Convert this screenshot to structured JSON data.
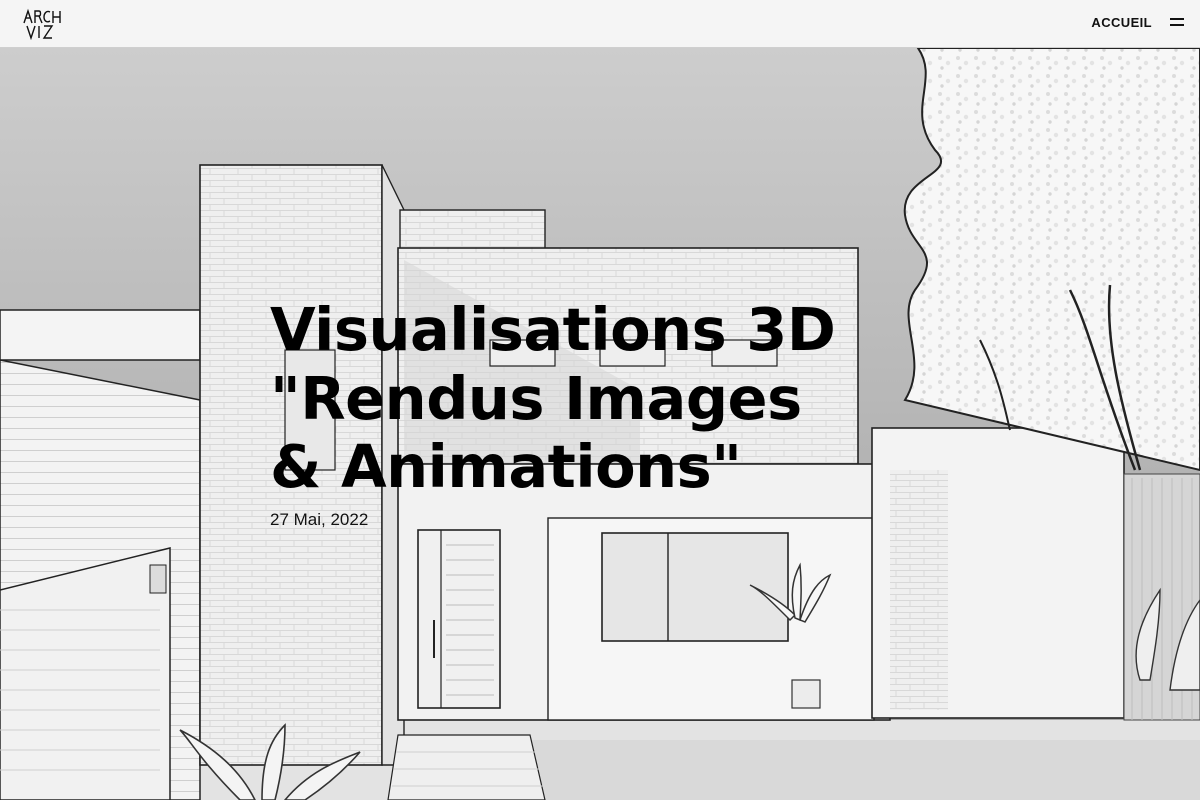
{
  "header": {
    "logo_text": "ARCH VIZ",
    "nav_link": "ACCUEIL",
    "menu_icon": "hamburger-icon"
  },
  "article": {
    "title_lines": [
      "Visualisations 3D",
      "\"Rendus Images",
      "& Animations\""
    ],
    "date": "27 Mai, 2022"
  },
  "colors": {
    "background": "#ececec",
    "text": "#000000"
  }
}
